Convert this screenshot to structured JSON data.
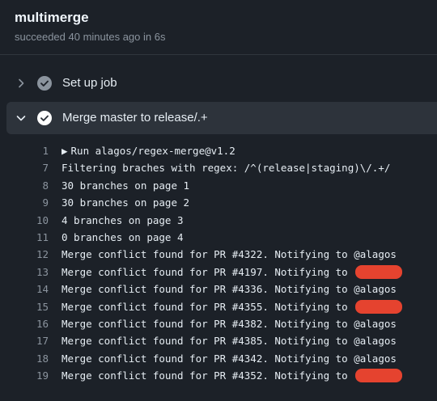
{
  "header": {
    "title": "multimerge",
    "status": "succeeded 40 minutes ago in 6s"
  },
  "colors": {
    "background": "#1c2128",
    "expanded_step_bg": "#2d333b",
    "check_collapsed": "#8b949e",
    "check_expanded": "#ffffff",
    "redaction": "#e5432f"
  },
  "steps": [
    {
      "label": "Set up job",
      "expanded": false,
      "icon": "chevron-right-icon",
      "status_icon": "check-circle-icon"
    },
    {
      "label": "Merge master to release/.+",
      "expanded": true,
      "icon": "chevron-down-icon",
      "status_icon": "check-circle-icon"
    }
  ],
  "log": [
    {
      "no": "1",
      "text": "Run alagos/regex-merge@v1.2",
      "prefix": "▶"
    },
    {
      "no": "7",
      "text": "Filtering braches with regex: /^(release|staging)\\/.+/"
    },
    {
      "no": "8",
      "text": "30 branches on page 1"
    },
    {
      "no": "9",
      "text": "30 branches on page 2"
    },
    {
      "no": "10",
      "text": "4 branches on page 3"
    },
    {
      "no": "11",
      "text": "0 branches on page 4"
    },
    {
      "no": "12",
      "text": "Merge conflict found for PR #4322. Notifying to @alagos"
    },
    {
      "no": "13",
      "text": "Merge conflict found for PR #4197. Notifying to ",
      "redacted": true
    },
    {
      "no": "14",
      "text": "Merge conflict found for PR #4336. Notifying to @alagos"
    },
    {
      "no": "15",
      "text": "Merge conflict found for PR #4355. Notifying to ",
      "redacted": true
    },
    {
      "no": "16",
      "text": "Merge conflict found for PR #4382. Notifying to @alagos"
    },
    {
      "no": "17",
      "text": "Merge conflict found for PR #4385. Notifying to @alagos"
    },
    {
      "no": "18",
      "text": "Merge conflict found for PR #4342. Notifying to @alagos"
    },
    {
      "no": "19",
      "text": "Merge conflict found for PR #4352. Notifying to ",
      "redacted": true
    }
  ]
}
